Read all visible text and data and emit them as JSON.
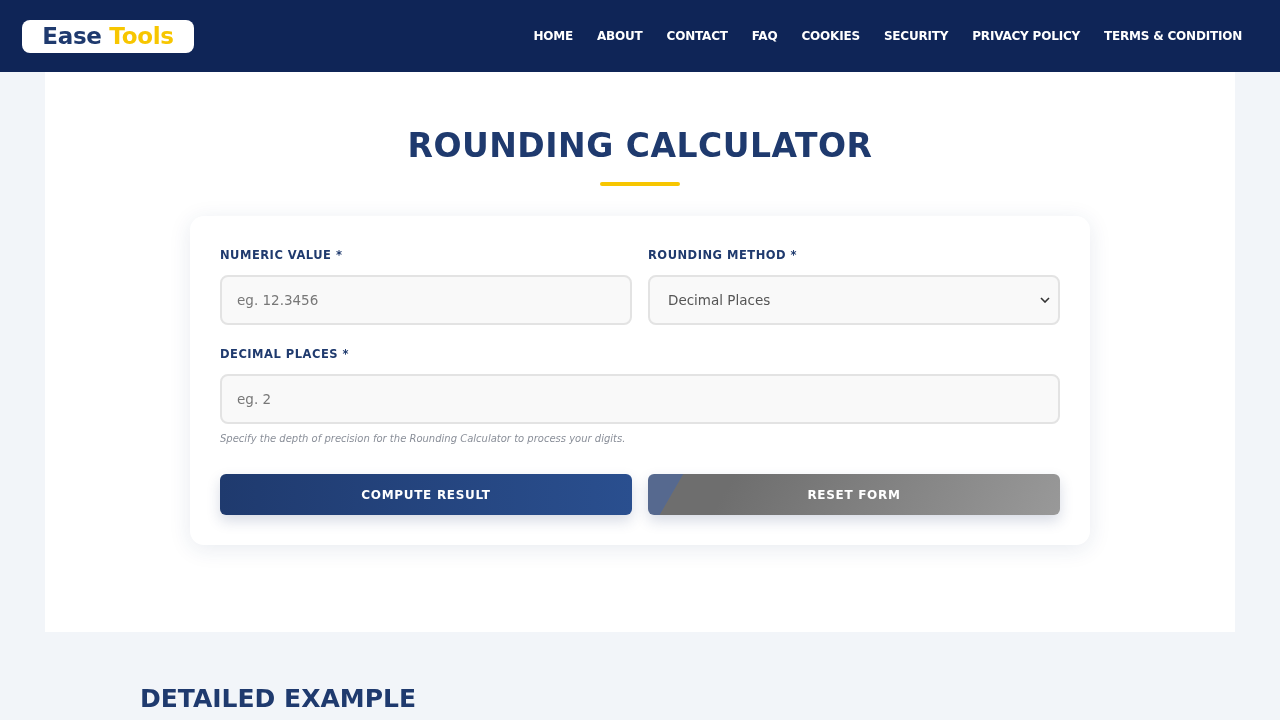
{
  "header": {
    "logo": {
      "text": "Ease",
      "accent": "Tools"
    },
    "nav": [
      "HOME",
      "ABOUT",
      "CONTACT",
      "FAQ",
      "COOKIES",
      "SECURITY",
      "PRIVACY POLICY",
      "TERMS & CONDITION"
    ]
  },
  "calculator": {
    "title": "ROUNDING CALCULATOR",
    "rows": [
      [
        {
          "kind": "input",
          "label": "NUMERIC VALUE *",
          "placeholder": "eg. 12.3456"
        },
        {
          "kind": "select",
          "label": "ROUNDING METHOD *",
          "value": "Decimal Places"
        }
      ],
      [
        {
          "kind": "input",
          "label": "DECIMAL PLACES *",
          "placeholder": "eg. 2",
          "hint": "Specify the depth of precision for the Rounding Calculator to process your digits."
        }
      ]
    ],
    "buttons": [
      {
        "kind": "primary",
        "label": "COMPUTE RESULT"
      },
      {
        "kind": "reset",
        "label": "RESET FORM"
      }
    ]
  },
  "example": {
    "title": "DETAILED EXAMPLE"
  }
}
